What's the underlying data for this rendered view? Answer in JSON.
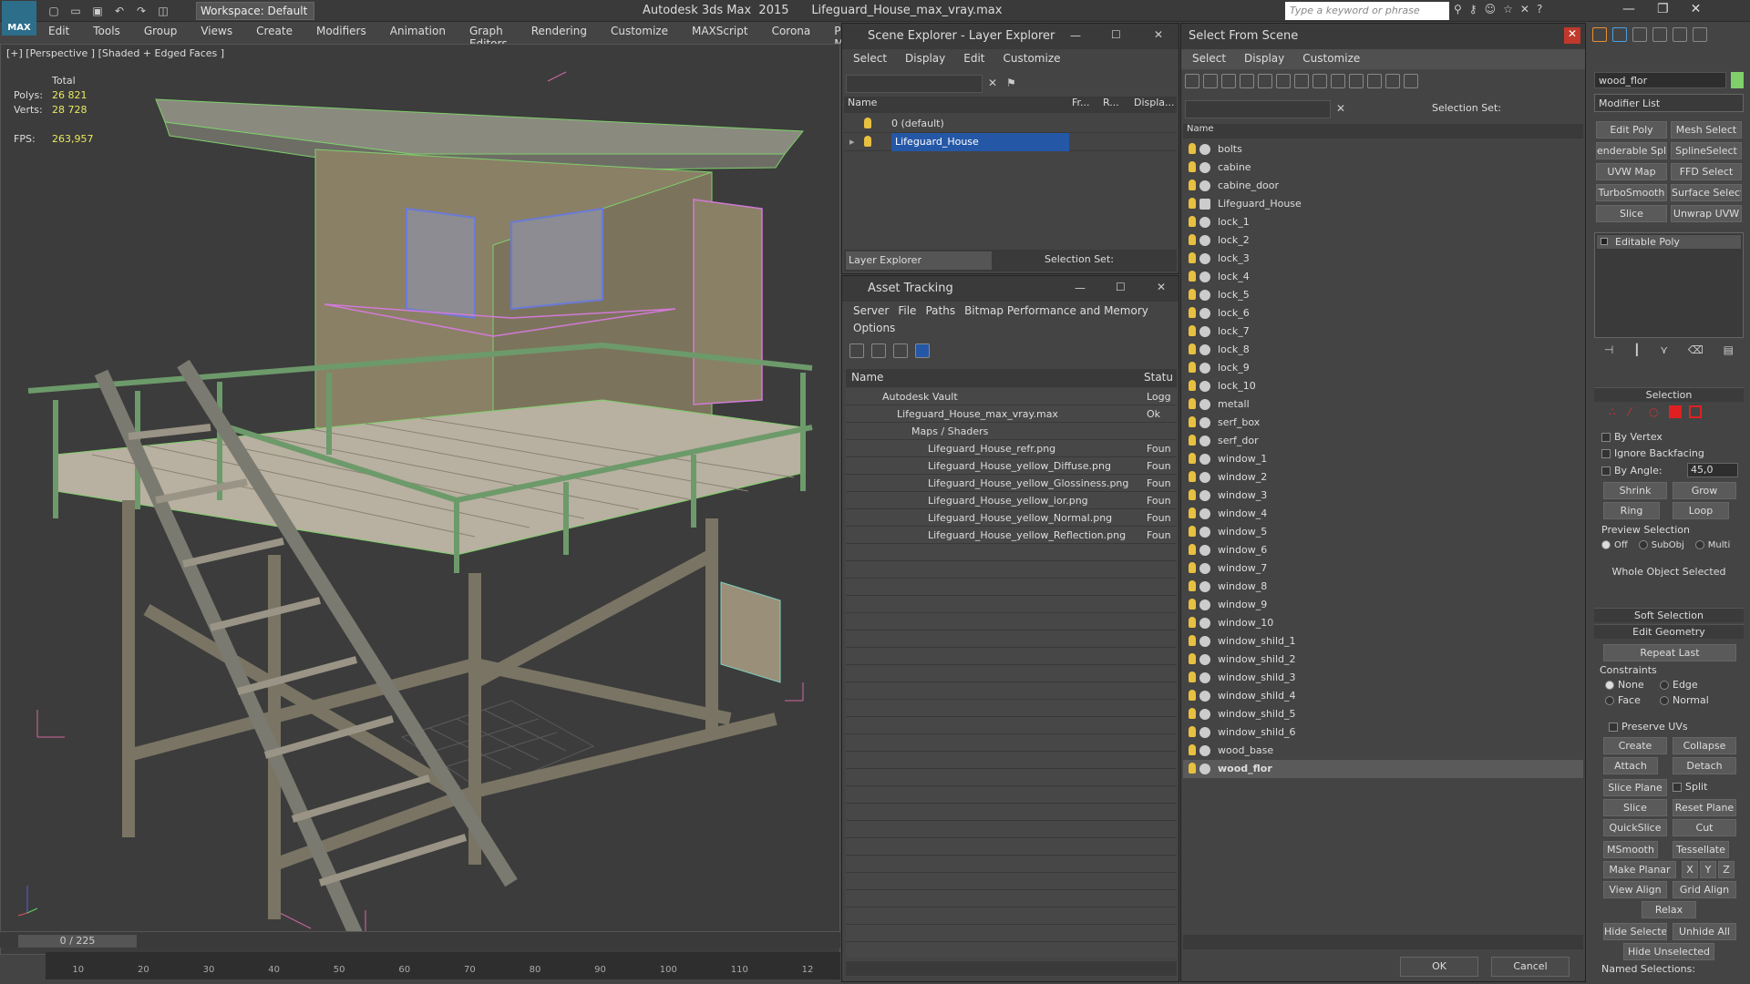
{
  "titlebar": {
    "workspace": "Workspace: Default",
    "app_title": "Autodesk 3ds Max  2015      Lifeguard_House_max_vray.max",
    "search_placeholder": "Type a keyword or phrase",
    "logo": "MAX"
  },
  "menubar": [
    "Edit",
    "Tools",
    "Group",
    "Views",
    "Create",
    "Modifiers",
    "Animation",
    "Graph Editors",
    "Rendering",
    "Customize",
    "MAXScript",
    "Corona",
    "Project Man"
  ],
  "viewport": {
    "label": "[+] [Perspective ] [Shaded + Edged Faces ]",
    "stats": {
      "total": "Total",
      "polys_label": "Polys:",
      "polys": "26 821",
      "verts_label": "Verts:",
      "verts": "28 728",
      "fps_label": "FPS:",
      "fps": "263,957"
    },
    "time": "0 / 225",
    "ruler": [
      "10",
      "20",
      "30",
      "40",
      "50",
      "60",
      "70",
      "80",
      "90",
      "100",
      "110",
      "12"
    ]
  },
  "scene_explorer": {
    "title": "Scene Explorer - Layer Explorer",
    "menu": [
      "Select",
      "Display",
      "Edit",
      "Customize"
    ],
    "columns": [
      "Name",
      "Fr...",
      "R...",
      "Displa..."
    ],
    "rows": [
      "0 (default)",
      "Lifeguard_House"
    ],
    "footer": "Layer Explorer",
    "selection_set": "Selection Set:"
  },
  "asset_tracking": {
    "title": "Asset Tracking",
    "menu": [
      "Server",
      "File",
      "Paths",
      "Bitmap Performance and Memory"
    ],
    "menu2": "Options",
    "columns": [
      "Name",
      "Statu"
    ],
    "rows": [
      {
        "name": "Autodesk Vault",
        "status": "Logg"
      },
      {
        "name": "Lifeguard_House_max_vray.max",
        "status": "Ok"
      },
      {
        "name": "Maps / Shaders",
        "status": ""
      },
      {
        "name": "Lifeguard_House_refr.png",
        "status": "Foun"
      },
      {
        "name": "Lifeguard_House_yellow_Diffuse.png",
        "status": "Foun"
      },
      {
        "name": "Lifeguard_House_yellow_Glossiness.png",
        "status": "Foun"
      },
      {
        "name": "Lifeguard_House_yellow_ior.png",
        "status": "Foun"
      },
      {
        "name": "Lifeguard_House_yellow_Normal.png",
        "status": "Foun"
      },
      {
        "name": "Lifeguard_House_yellow_Reflection.png",
        "status": "Foun"
      }
    ]
  },
  "select_from_scene": {
    "title": "Select From Scene",
    "menu": [
      "Select",
      "Display",
      "Customize"
    ],
    "selection_set": "Selection Set:",
    "column": "Name",
    "items": [
      "bolts",
      "cabine",
      "cabine_door",
      "Lifeguard_House",
      "lock_1",
      "lock_2",
      "lock_3",
      "lock_4",
      "lock_5",
      "lock_6",
      "lock_7",
      "lock_8",
      "lock_9",
      "lock_10",
      "metall",
      "serf_box",
      "serf_dor",
      "window_1",
      "window_2",
      "window_3",
      "window_4",
      "window_5",
      "window_6",
      "window_7",
      "window_8",
      "window_9",
      "window_10",
      "window_shild_1",
      "window_shild_2",
      "window_shild_3",
      "window_shild_4",
      "window_shild_5",
      "window_shild_6",
      "wood_base",
      "wood_flor"
    ],
    "selected": "wood_flor",
    "ok": "OK",
    "cancel": "Cancel"
  },
  "command_panel": {
    "object_name": "wood_flor",
    "modifier_list": "Modifier List",
    "modifier_buttons": [
      "Edit Poly",
      "Mesh Select",
      "enderable Splir",
      "SplineSelect",
      "UVW Map",
      "FFD Select",
      "TurboSmooth",
      "Surface Select",
      "Slice",
      "Unwrap UVW"
    ],
    "stack_item": "Editable Poly",
    "selection": {
      "title": "Selection",
      "by_vertex": "By Vertex",
      "ignore_backfacing": "Ignore Backfacing",
      "by_angle": "By Angle:",
      "angle_value": "45,0",
      "shrink": "Shrink",
      "grow": "Grow",
      "ring": "Ring",
      "loop": "Loop",
      "preview": "Preview Selection",
      "off": "Off",
      "subobj": "SubObj",
      "multi": "Multi",
      "whole": "Whole Object Selected"
    },
    "soft_selection": "Soft Selection",
    "edit_geometry": {
      "title": "Edit Geometry",
      "repeat_last": "Repeat Last",
      "constraints": "Constraints",
      "none": "None",
      "edge": "Edge",
      "face": "Face",
      "normal": "Normal",
      "preserve_uvs": "Preserve UVs",
      "create": "Create",
      "collapse": "Collapse",
      "attach": "Attach",
      "detach": "Detach",
      "slice_plane": "Slice Plane",
      "split": "Split",
      "slice": "Slice",
      "reset_plane": "Reset Plane",
      "quickslice": "QuickSlice",
      "cut": "Cut",
      "msmooth": "MSmooth",
      "tessellate": "Tessellate",
      "make_planar": "Make Planar",
      "x": "X",
      "y": "Y",
      "z": "Z",
      "view_align": "View Align",
      "grid_align": "Grid Align",
      "relax": "Relax",
      "hide_selected": "Hide Selected",
      "unhide_all": "Unhide All",
      "hide_unselected": "Hide Unselected",
      "named_selections": "Named Selections:"
    }
  },
  "colors": {
    "accent": "#2d6e8a",
    "selected_row": "#2457a6",
    "stat_value": "#e8e860",
    "wire_green": "#7fd06a",
    "wire_pink": "#d27ad8"
  }
}
